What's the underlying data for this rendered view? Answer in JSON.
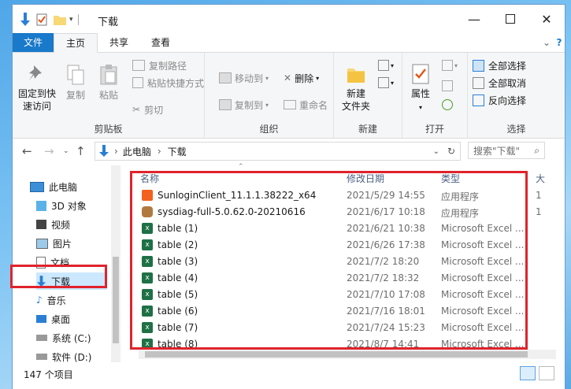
{
  "window": {
    "title": "下载"
  },
  "tabs": [
    {
      "label": "文件"
    },
    {
      "label": "主页"
    },
    {
      "label": "共享"
    },
    {
      "label": "查看"
    }
  ],
  "ribbon": {
    "clipboard": {
      "label": "剪贴板",
      "pin": "固定到快\n速访问",
      "copy": "复制",
      "paste": "粘贴",
      "copy_path": "复制路径",
      "paste_shortcut": "粘贴快捷方式",
      "cut": "剪切"
    },
    "organize": {
      "label": "组织",
      "move_to": "移动到",
      "copy_to": "复制到",
      "delete": "删除",
      "rename": "重命名"
    },
    "new": {
      "label": "新建",
      "new_folder": "新建\n文件夹"
    },
    "open": {
      "label": "打开",
      "properties": "属性"
    },
    "select": {
      "label": "选择",
      "select_all": "全部选择",
      "select_none": "全部取消",
      "invert": "反向选择"
    }
  },
  "address": {
    "crumbs": [
      "此电脑",
      "下载"
    ],
    "search_placeholder": "搜索\"下载\""
  },
  "nav": {
    "items": [
      "此电脑",
      "3D 对象",
      "视频",
      "图片",
      "文档",
      "下载",
      "音乐",
      "桌面",
      "系统 (C:)",
      "软件 (D:)"
    ]
  },
  "columns": {
    "name": "名称",
    "date": "修改日期",
    "type": "类型",
    "size": "大"
  },
  "files": [
    {
      "name": "SunloginClient_11.1.1.38222_x64",
      "date": "2021/5/29 14:55",
      "type": "应用程序",
      "size": "1",
      "icon": "sunlogin-icon"
    },
    {
      "name": "sysdiag-full-5.0.62.0-20210616",
      "date": "2021/6/17 10:18",
      "type": "应用程序",
      "size": "1",
      "icon": "installer-icon"
    },
    {
      "name": "table (1)",
      "date": "2021/6/21 10:38",
      "type": "Microsoft Excel ...",
      "size": "",
      "icon": "excel-icon"
    },
    {
      "name": "table (2)",
      "date": "2021/6/26 17:38",
      "type": "Microsoft Excel ...",
      "size": "",
      "icon": "excel-icon"
    },
    {
      "name": "table (3)",
      "date": "2021/7/2 18:20",
      "type": "Microsoft Excel ...",
      "size": "",
      "icon": "excel-icon"
    },
    {
      "name": "table (4)",
      "date": "2021/7/2 18:32",
      "type": "Microsoft Excel ...",
      "size": "",
      "icon": "excel-icon"
    },
    {
      "name": "table (5)",
      "date": "2021/7/10 17:08",
      "type": "Microsoft Excel ...",
      "size": "",
      "icon": "excel-icon"
    },
    {
      "name": "table (6)",
      "date": "2021/7/16 18:01",
      "type": "Microsoft Excel ...",
      "size": "",
      "icon": "excel-icon"
    },
    {
      "name": "table (7)",
      "date": "2021/7/24 15:23",
      "type": "Microsoft Excel ...",
      "size": "",
      "icon": "excel-icon"
    },
    {
      "name": "table (8)",
      "date": "2021/8/7 14:41",
      "type": "Microsoft Excel ...",
      "size": "",
      "icon": "excel-icon"
    }
  ],
  "status": {
    "count": "147 个项目"
  },
  "colors": {
    "accent": "#1979ca",
    "highlight_box": "#e0232c",
    "excel": "#1e7145",
    "sunlogin": "#f2611d"
  }
}
